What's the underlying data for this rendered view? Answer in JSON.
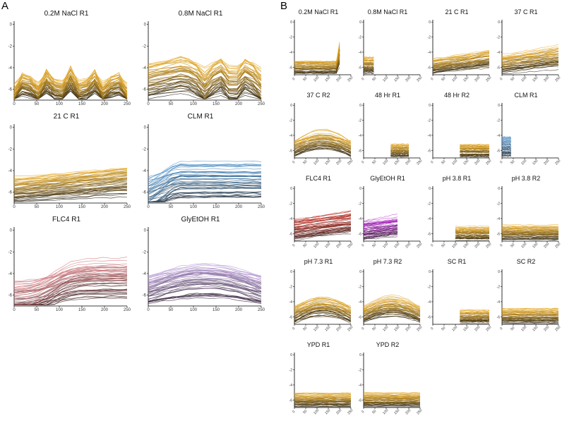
{
  "panel_labels": [
    "A",
    "B"
  ],
  "colors": {
    "gold_dark": "#1a1408",
    "gold_light": "#e8a81e",
    "blue_dark": "#1b2630",
    "blue_light": "#4f93cc",
    "red_dark": "#2a0c0a",
    "red_light": "#c0261a",
    "purple_dark": "#2a1228",
    "purple_light": "#b020c8",
    "rose_dark": "#2a0e0e",
    "rose_light": "#d87a80",
    "violet_dark": "#241428",
    "violet_light": "#b89ad8"
  },
  "chart_data": [
    {
      "panel": "A",
      "type": "line",
      "title": "0.2M NaCl R1",
      "x_ticks": [
        0,
        50,
        100,
        150,
        200,
        250
      ],
      "y_ticks": [
        0,
        -2,
        -4,
        -6
      ],
      "xlim": [
        0,
        250
      ],
      "ylim": [
        -7,
        0.3
      ],
      "x_range": [
        0,
        250
      ],
      "palette": [
        "gold_dark",
        "gold_light"
      ],
      "pattern": "zigzag",
      "level": -4.8,
      "n_lines": 50
    },
    {
      "panel": "A",
      "type": "line",
      "title": "0.8M NaCl R1",
      "x_ticks": [
        0,
        50,
        100,
        150,
        200,
        250
      ],
      "y_ticks": [
        0,
        -2,
        -4,
        -6
      ],
      "xlim": [
        0,
        250
      ],
      "ylim": [
        -7,
        0.3
      ],
      "x_range": [
        0,
        250
      ],
      "palette": [
        "gold_dark",
        "gold_light"
      ],
      "pattern": "rise_zig",
      "level": -3.5,
      "n_lines": 50
    },
    {
      "panel": "A",
      "type": "line",
      "title": "21 C R1",
      "x_ticks": [
        0,
        50,
        100,
        150,
        200,
        250
      ],
      "y_ticks": [
        0,
        -2,
        -4,
        -6
      ],
      "xlim": [
        0,
        250
      ],
      "ylim": [
        -7,
        0.3
      ],
      "x_range": [
        0,
        250
      ],
      "palette": [
        "gold_dark",
        "gold_light"
      ],
      "pattern": "slow_rise",
      "level": -4.5,
      "n_lines": 50
    },
    {
      "panel": "A",
      "type": "line",
      "title": "CLM R1",
      "x_ticks": [
        0,
        50,
        100,
        150,
        200,
        250
      ],
      "y_ticks": [
        0,
        -2,
        -4,
        -6
      ],
      "xlim": [
        0,
        250
      ],
      "ylim": [
        -7,
        0.3
      ],
      "x_range": [
        0,
        250
      ],
      "palette": [
        "blue_dark",
        "blue_light"
      ],
      "pattern": "early_rise",
      "level": -3.5,
      "n_lines": 50
    },
    {
      "panel": "A",
      "type": "line",
      "title": "FLC4 R1",
      "x_ticks": [
        0,
        50,
        100,
        150,
        200,
        250
      ],
      "y_ticks": [
        0,
        -2,
        -4,
        -6
      ],
      "xlim": [
        0,
        250
      ],
      "ylim": [
        -7,
        0.3
      ],
      "x_range": [
        0,
        250
      ],
      "palette": [
        "rose_dark",
        "rose_light"
      ],
      "pattern": "sigmoid",
      "level": -3.8,
      "n_lines": 50
    },
    {
      "panel": "A",
      "type": "line",
      "title": "GlyEtOH R1",
      "x_ticks": [
        0,
        50,
        100,
        150,
        200,
        250
      ],
      "y_ticks": [
        0,
        -2,
        -4,
        -6
      ],
      "xlim": [
        0,
        250
      ],
      "ylim": [
        -7,
        0.3
      ],
      "x_range": [
        0,
        250
      ],
      "palette": [
        "violet_dark",
        "violet_light"
      ],
      "pattern": "hump",
      "level": -4,
      "n_lines": 50
    },
    {
      "panel": "B",
      "type": "line",
      "title": "0.2M NaCl R1",
      "x_ticks": [
        0,
        50,
        100,
        150,
        200,
        250
      ],
      "y_ticks": [
        0,
        -2,
        -4,
        -6
      ],
      "xlim": [
        0,
        250
      ],
      "ylim": [
        -7,
        0.3
      ],
      "x_range": [
        0,
        200
      ],
      "palette": [
        "gold_dark",
        "gold_light"
      ],
      "pattern": "spike",
      "level": -5,
      "n_lines": 50
    },
    {
      "panel": "B",
      "type": "line",
      "title": "0.8M NaCl R1",
      "x_ticks": [
        0,
        50,
        100,
        150,
        200,
        250
      ],
      "y_ticks": [
        0,
        -2,
        -4,
        -6
      ],
      "xlim": [
        0,
        250
      ],
      "ylim": [
        -7,
        0.3
      ],
      "x_range": [
        0,
        45
      ],
      "palette": [
        "gold_dark",
        "gold_light"
      ],
      "pattern": "flat",
      "level": -4.5,
      "n_lines": 50
    },
    {
      "panel": "B",
      "type": "line",
      "title": "21 C R1",
      "x_ticks": [
        0,
        50,
        100,
        150,
        200,
        250
      ],
      "y_ticks": [
        0,
        -2,
        -4,
        -6
      ],
      "xlim": [
        0,
        250
      ],
      "ylim": [
        -7,
        0.3
      ],
      "x_range": [
        0,
        250
      ],
      "palette": [
        "gold_dark",
        "gold_light"
      ],
      "pattern": "slow_rise",
      "level": -4.8,
      "n_lines": 50
    },
    {
      "panel": "B",
      "type": "line",
      "title": "37 C R1",
      "x_ticks": [
        0,
        50,
        100,
        150,
        200,
        250
      ],
      "y_ticks": [
        0,
        -2,
        -4,
        -6
      ],
      "xlim": [
        0,
        250
      ],
      "ylim": [
        -7,
        0.3
      ],
      "x_range": [
        0,
        250
      ],
      "palette": [
        "gold_dark",
        "gold_light"
      ],
      "pattern": "slow_rise",
      "level": -4.3,
      "n_lines": 50
    },
    {
      "panel": "B",
      "type": "line",
      "title": "37 C R2",
      "x_ticks": [
        0,
        50,
        100,
        150,
        200,
        250
      ],
      "y_ticks": [
        0,
        -2,
        -4,
        -6
      ],
      "xlim": [
        0,
        250
      ],
      "ylim": [
        -7,
        0.3
      ],
      "x_range": [
        0,
        250
      ],
      "palette": [
        "gold_dark",
        "gold_light"
      ],
      "pattern": "hump",
      "level": -4.5,
      "n_lines": 50
    },
    {
      "panel": "B",
      "type": "line",
      "title": "48 Hr R1",
      "x_ticks": [
        0,
        50,
        100,
        150,
        200,
        250
      ],
      "y_ticks": [
        0,
        -2,
        -4,
        -6
      ],
      "xlim": [
        0,
        250
      ],
      "ylim": [
        -7,
        0.3
      ],
      "x_range": [
        120,
        200
      ],
      "palette": [
        "gold_dark",
        "gold_light"
      ],
      "pattern": "flat",
      "level": -5,
      "n_lines": 50
    },
    {
      "panel": "B",
      "type": "line",
      "title": "48 Hr R2",
      "x_ticks": [
        0,
        50,
        100,
        150,
        200,
        250
      ],
      "y_ticks": [
        0,
        -2,
        -4,
        -6
      ],
      "xlim": [
        0,
        250
      ],
      "ylim": [
        -7,
        0.3
      ],
      "x_range": [
        120,
        250
      ],
      "palette": [
        "gold_dark",
        "gold_light"
      ],
      "pattern": "flat",
      "level": -5,
      "n_lines": 50
    },
    {
      "panel": "B",
      "type": "line",
      "title": "CLM R1",
      "x_ticks": [
        0,
        50,
        100,
        150,
        200,
        250
      ],
      "y_ticks": [
        0,
        -2,
        -4,
        -6
      ],
      "xlim": [
        0,
        250
      ],
      "ylim": [
        -7,
        0.3
      ],
      "x_range": [
        0,
        40
      ],
      "palette": [
        "blue_dark",
        "blue_light"
      ],
      "pattern": "flat",
      "level": -4,
      "n_lines": 50
    },
    {
      "panel": "B",
      "type": "line",
      "title": "FLC4 R1",
      "x_ticks": [
        0,
        50,
        100,
        150,
        200,
        250
      ],
      "y_ticks": [
        0,
        -2,
        -4,
        -6
      ],
      "xlim": [
        0,
        250
      ],
      "ylim": [
        -7,
        0.3
      ],
      "x_range": [
        0,
        250
      ],
      "palette": [
        "red_dark",
        "red_light"
      ],
      "pattern": "slow_rise",
      "level": -4,
      "n_lines": 50
    },
    {
      "panel": "B",
      "type": "line",
      "title": "GlyEtOH R1",
      "x_ticks": [
        0,
        50,
        100,
        150,
        200,
        250
      ],
      "y_ticks": [
        0,
        -2,
        -4,
        -6
      ],
      "xlim": [
        0,
        250
      ],
      "ylim": [
        -7,
        0.3
      ],
      "x_range": [
        0,
        150
      ],
      "palette": [
        "purple_dark",
        "purple_light"
      ],
      "pattern": "slow_rise",
      "level": -4.2,
      "n_lines": 50
    },
    {
      "panel": "B",
      "type": "line",
      "title": "pH 3.8 R1",
      "x_ticks": [
        0,
        50,
        100,
        150,
        200,
        250
      ],
      "y_ticks": [
        0,
        -2,
        -4,
        -6
      ],
      "xlim": [
        0,
        250
      ],
      "ylim": [
        -7,
        0.3
      ],
      "x_range": [
        100,
        250
      ],
      "palette": [
        "gold_dark",
        "gold_light"
      ],
      "pattern": "flat",
      "level": -5,
      "n_lines": 50
    },
    {
      "panel": "B",
      "type": "line",
      "title": "pH 3.8 R2",
      "x_ticks": [
        0,
        50,
        100,
        150,
        200,
        250
      ],
      "y_ticks": [
        0,
        -2,
        -4,
        -6
      ],
      "xlim": [
        0,
        250
      ],
      "ylim": [
        -7,
        0.3
      ],
      "x_range": [
        0,
        250
      ],
      "palette": [
        "gold_dark",
        "gold_light"
      ],
      "pattern": "flat",
      "level": -4.8,
      "n_lines": 50
    },
    {
      "panel": "B",
      "type": "line",
      "title": "pH 7.3 R1",
      "x_ticks": [
        0,
        50,
        100,
        150,
        200,
        250
      ],
      "y_ticks": [
        0,
        -2,
        -4,
        -6
      ],
      "xlim": [
        0,
        250
      ],
      "ylim": [
        -7,
        0.3
      ],
      "x_range": [
        0,
        250
      ],
      "palette": [
        "gold_dark",
        "gold_light"
      ],
      "pattern": "hump",
      "level": -4.5,
      "n_lines": 50
    },
    {
      "panel": "B",
      "type": "line",
      "title": "pH 7.3 R2",
      "x_ticks": [
        0,
        50,
        100,
        150,
        200,
        250
      ],
      "y_ticks": [
        0,
        -2,
        -4,
        -6
      ],
      "xlim": [
        0,
        250
      ],
      "ylim": [
        -7,
        0.3
      ],
      "x_range": [
        0,
        250
      ],
      "palette": [
        "gold_dark",
        "gold_light"
      ],
      "pattern": "hump",
      "level": -4.5,
      "n_lines": 50
    },
    {
      "panel": "B",
      "type": "line",
      "title": "SC R1",
      "x_ticks": [
        0,
        50,
        100,
        150,
        200,
        250
      ],
      "y_ticks": [
        0,
        -2,
        -4,
        -6
      ],
      "xlim": [
        0,
        250
      ],
      "ylim": [
        -7,
        0.3
      ],
      "x_range": [
        120,
        250
      ],
      "palette": [
        "gold_dark",
        "gold_light"
      ],
      "pattern": "flat",
      "level": -5,
      "n_lines": 50
    },
    {
      "panel": "B",
      "type": "line",
      "title": "SC R2",
      "x_ticks": [
        0,
        50,
        100,
        150,
        200,
        250
      ],
      "y_ticks": [
        0,
        -2,
        -4,
        -6
      ],
      "xlim": [
        0,
        250
      ],
      "ylim": [
        -7,
        0.3
      ],
      "x_range": [
        0,
        250
      ],
      "palette": [
        "gold_dark",
        "gold_light"
      ],
      "pattern": "flat",
      "level": -4.8,
      "n_lines": 50
    },
    {
      "panel": "B",
      "type": "line",
      "title": "YPD R1",
      "x_ticks": [
        0,
        50,
        100,
        150,
        200,
        250
      ],
      "y_ticks": [
        0,
        -2,
        -4,
        -6
      ],
      "xlim": [
        0,
        250
      ],
      "ylim": [
        -7,
        0.3
      ],
      "x_range": [
        0,
        250
      ],
      "palette": [
        "gold_dark",
        "gold_light"
      ],
      "pattern": "flat",
      "level": -5,
      "n_lines": 50
    },
    {
      "panel": "B",
      "type": "line",
      "title": "YPD R2",
      "x_ticks": [
        0,
        50,
        100,
        150,
        200,
        250
      ],
      "y_ticks": [
        0,
        -2,
        -4,
        -6
      ],
      "xlim": [
        0,
        250
      ],
      "ylim": [
        -7,
        0.3
      ],
      "x_range": [
        0,
        250
      ],
      "palette": [
        "gold_dark",
        "gold_light"
      ],
      "pattern": "flat",
      "level": -5,
      "n_lines": 50
    }
  ]
}
